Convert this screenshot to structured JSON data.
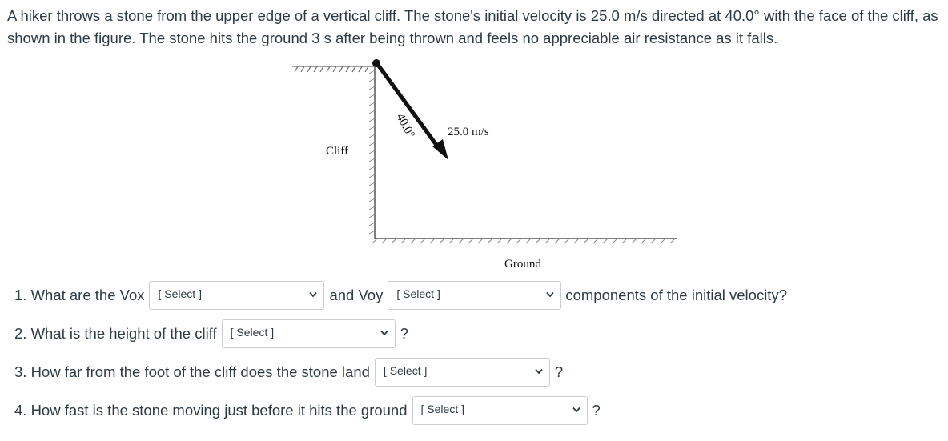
{
  "prompt": "A hiker throws a stone from the upper edge of a vertical cliff. The stone's initial velocity is 25.0 m/s directed at 40.0° with the face of the cliff, as shown in the figure. The stone hits the ground 3 s after being thrown and feels no appreciable air resistance as it falls.",
  "figure": {
    "cliff_label": "Cliff",
    "angle_label": "40.0°",
    "velocity_label": "25.0 m/s",
    "ground_label": "Ground"
  },
  "questions": [
    {
      "before": "1. What are the Vox",
      "select1": "[ Select ]",
      "middle": "and Voy",
      "select2": "[ Select ]",
      "after": "components of the initial velocity?"
    },
    {
      "before": "2. What is the height of the cliff",
      "select1": "[ Select ]",
      "after": "?"
    },
    {
      "before": "3. How far from the foot of the cliff does the stone land",
      "select1": "[ Select ]",
      "after": "?"
    },
    {
      "before": "4. How fast is the stone moving just before it hits the ground",
      "select1": "[ Select ]",
      "after": "?"
    }
  ],
  "icons": {
    "dropdown": "chevron-down-icon"
  },
  "colors": {
    "text": "#2d3b45",
    "border": "#c7cdd1"
  }
}
